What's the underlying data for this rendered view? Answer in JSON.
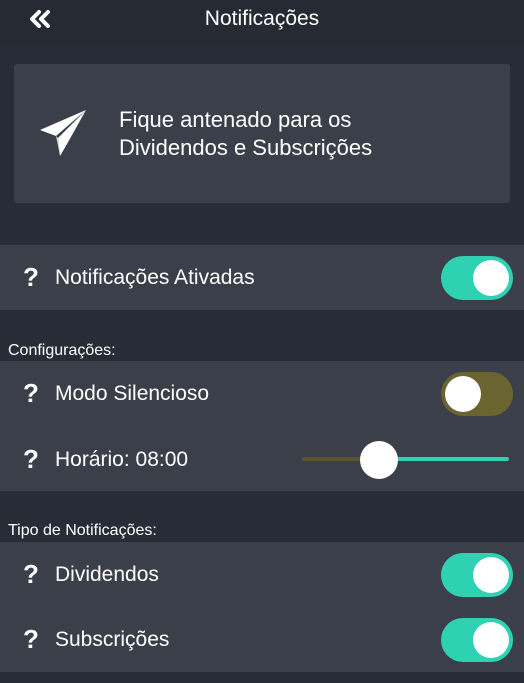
{
  "header": {
    "title": "Notificações",
    "back_icon": "double-chevron-left-icon"
  },
  "hero": {
    "icon": "paper-plane-icon",
    "line1": "Fique antenado para os",
    "line2": "Dividendos e Subscrições"
  },
  "main_toggle": {
    "label": "Notificações Ativadas",
    "enabled": true
  },
  "config": {
    "section_label": "Configurações:",
    "silent_mode": {
      "label": "Modo Silencioso",
      "enabled": false
    },
    "schedule": {
      "label": "Horário: 08:00",
      "slider_fraction": 0.37
    }
  },
  "types": {
    "section_label": "Tipo de Notificações:",
    "dividendos": {
      "label": "Dividendos",
      "enabled": true
    },
    "subscricoes": {
      "label": "Subscrições",
      "enabled": true
    }
  },
  "colors": {
    "accent_on": "#2fd1b3",
    "toggle_off": "#6a6430",
    "panel": "#3b3f49",
    "background": "#272c36"
  }
}
